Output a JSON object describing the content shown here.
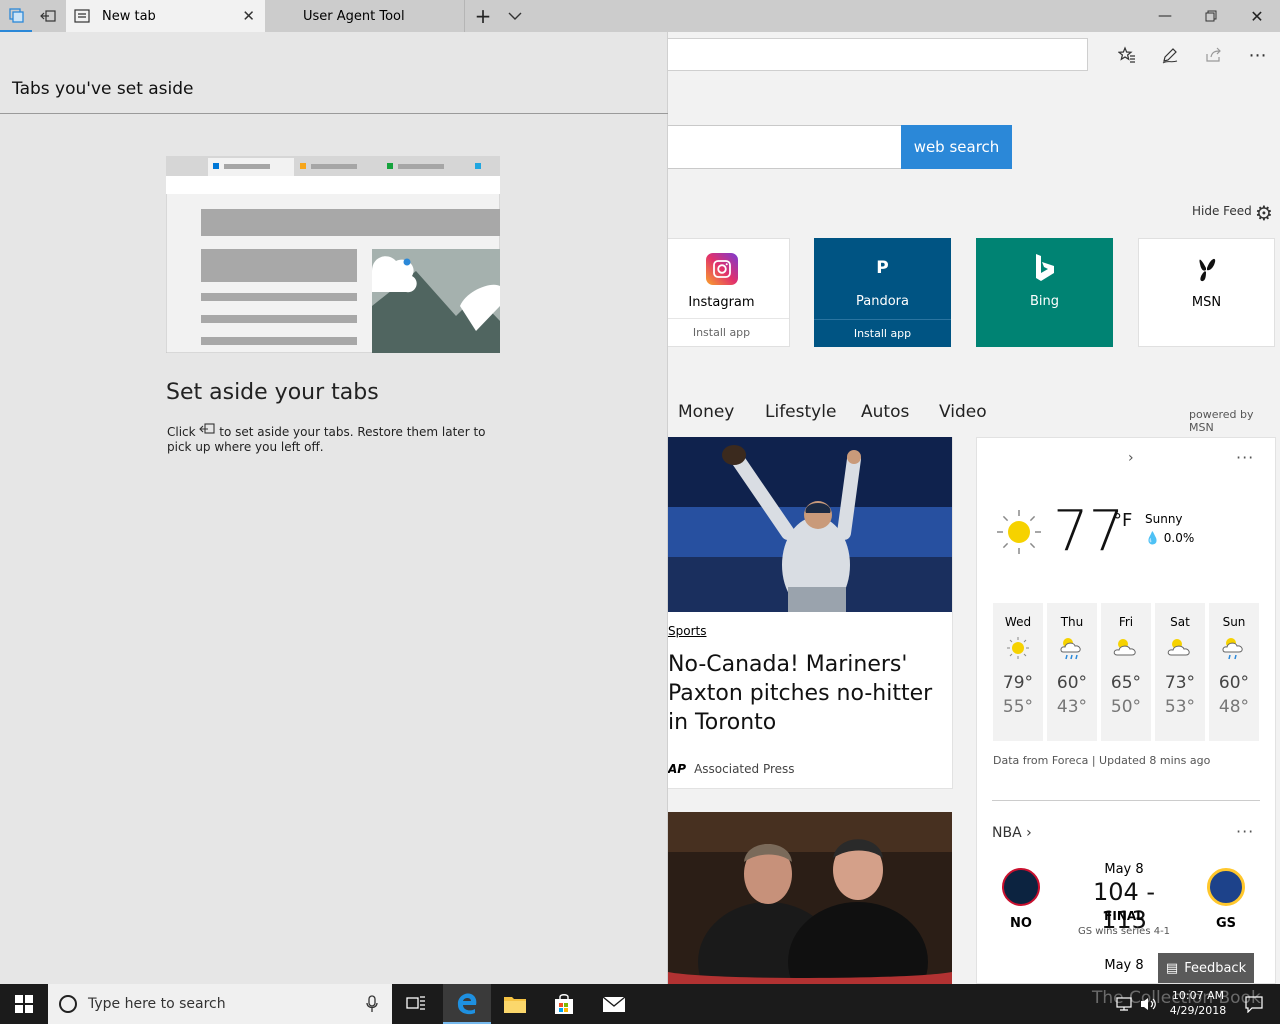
{
  "tabs": [
    {
      "label": "New tab",
      "active": true
    },
    {
      "label": "User Agent Tool",
      "active": false
    }
  ],
  "toolbar": {
    "icons": [
      "set-aside-tabs-icon",
      "set-aside-icon",
      "favorites-icon",
      "pen-icon",
      "share-icon",
      "more-icon"
    ]
  },
  "newtab": {
    "search_button": "web search",
    "hide_feed": "Hide Feed",
    "tiles": [
      {
        "name": "Instagram",
        "sub": "Install app",
        "color": "#ffffff"
      },
      {
        "name": "Pandora",
        "sub": "Install app",
        "color": "#005483"
      },
      {
        "name": "Bing",
        "sub": "",
        "color": "#008373"
      },
      {
        "name": "MSN",
        "sub": "",
        "color": "#ffffff"
      }
    ],
    "categories": [
      "Money",
      "Lifestyle",
      "Autos",
      "Video"
    ],
    "powered_by": "powered by MSN"
  },
  "news": {
    "category": "Sports",
    "headline": "No-Canada! Mariners' Paxton pitches no-hitter in Toronto",
    "source_logo": "AP",
    "source": "Associated Press"
  },
  "weather": {
    "temp": "77",
    "unit": "°F",
    "condition": "Sunny",
    "precip": "0.0%",
    "forecast": [
      {
        "day": "Wed",
        "icon": "sun-icon",
        "hi": "79°",
        "lo": "55°"
      },
      {
        "day": "Thu",
        "icon": "rain-icon",
        "hi": "60°",
        "lo": "43°"
      },
      {
        "day": "Fri",
        "icon": "partly-cloudy-icon",
        "hi": "65°",
        "lo": "50°"
      },
      {
        "day": "Sat",
        "icon": "partly-cloudy-icon",
        "hi": "73°",
        "lo": "53°"
      },
      {
        "day": "Sun",
        "icon": "sun-shower-icon",
        "hi": "60°",
        "lo": "48°"
      }
    ],
    "data_note": "Data from Foreca | Updated 8 mins ago"
  },
  "nba": {
    "label": "NBA",
    "game": {
      "date": "May 8",
      "home_abbr": "NO",
      "away_abbr": "GS",
      "score": "104 - 113",
      "status": "FINAL",
      "note": "GS wins series 4-1"
    },
    "next_date": "May 8"
  },
  "feedback": "Feedback",
  "panel": {
    "title": "Tabs you've set aside",
    "heading": "Set aside your tabs",
    "desc_before": "Click",
    "desc_after": "to set aside your tabs. Restore them later to pick up where you left off."
  },
  "taskbar": {
    "search_placeholder": "Type here to search",
    "time": "10:07 AM",
    "date": "4/29/2018",
    "watermark": "The Collection Book"
  },
  "colors": {
    "accent": "#2b88d8",
    "pandora": "#005483",
    "bing": "#008373"
  }
}
